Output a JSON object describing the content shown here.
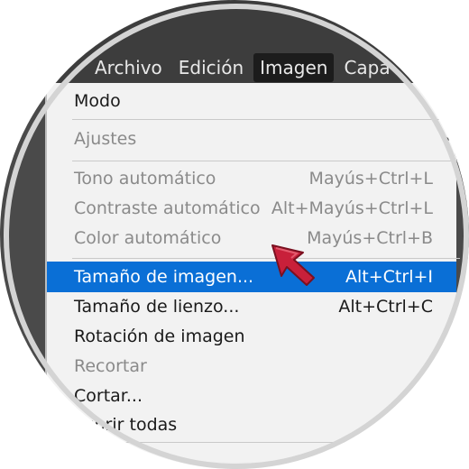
{
  "menubar": {
    "items": [
      {
        "label": "Archivo"
      },
      {
        "label": "Edición"
      },
      {
        "label": "Imagen"
      },
      {
        "label": "Capa"
      }
    ]
  },
  "menu": {
    "items": [
      {
        "label": "Modo",
        "shortcut": ""
      },
      {
        "label": "Ajustes",
        "shortcut": ""
      },
      {
        "label": "Tono automático",
        "shortcut": "Mayús+Ctrl+L"
      },
      {
        "label": "Contraste automático",
        "shortcut": "Alt+Mayús+Ctrl+L"
      },
      {
        "label": "Color automático",
        "shortcut": "Mayús+Ctrl+B"
      },
      {
        "label": "Tamaño de imagen...",
        "shortcut": "Alt+Ctrl+I"
      },
      {
        "label": "Tamaño de lienzo...",
        "shortcut": "Alt+Ctrl+C"
      },
      {
        "label": "Rotación de imagen",
        "shortcut": ""
      },
      {
        "label": "Recortar",
        "shortcut": ""
      },
      {
        "label": "Cortar...",
        "shortcut": ""
      },
      {
        "label": "cubrir todas",
        "shortcut": ""
      }
    ]
  },
  "pointer": {
    "icon": "red-arrow-icon",
    "color": "#c8203a"
  }
}
